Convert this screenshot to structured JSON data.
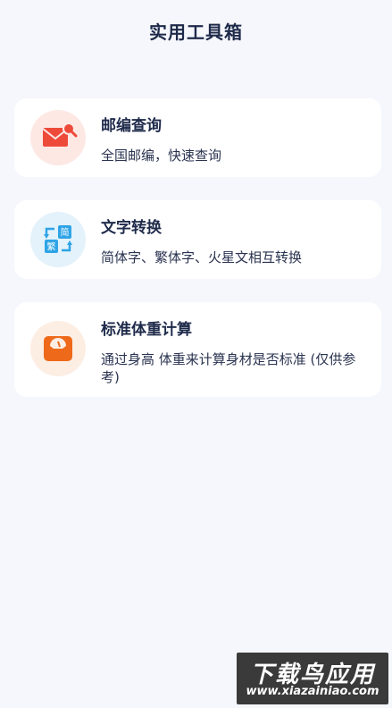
{
  "header": {
    "title": "实用工具箱"
  },
  "tools": [
    {
      "title": "邮编查询",
      "desc": "全国邮编，快速查询",
      "icon": "envelope-search-icon",
      "icon_bg": "#fde8e4",
      "icon_color": "#ee4a3a"
    },
    {
      "title": "文字转换",
      "desc": "简体字、繁体字、火星文相互转换",
      "icon": "convert-icon",
      "icon_bg": "#e3f2fb",
      "icon_color": "#2ea4e6",
      "icon_labels": [
        "简",
        "繁"
      ]
    },
    {
      "title": "标准体重计算",
      "desc": "通过身高 体重来计算身材是否标准 (仅供参考)",
      "icon": "scale-icon",
      "icon_bg": "#fdeee4",
      "icon_color": "#ee6a1a"
    }
  ],
  "watermark": {
    "main": "下载鸟应用",
    "sub": "www.xiazainiao.com"
  }
}
